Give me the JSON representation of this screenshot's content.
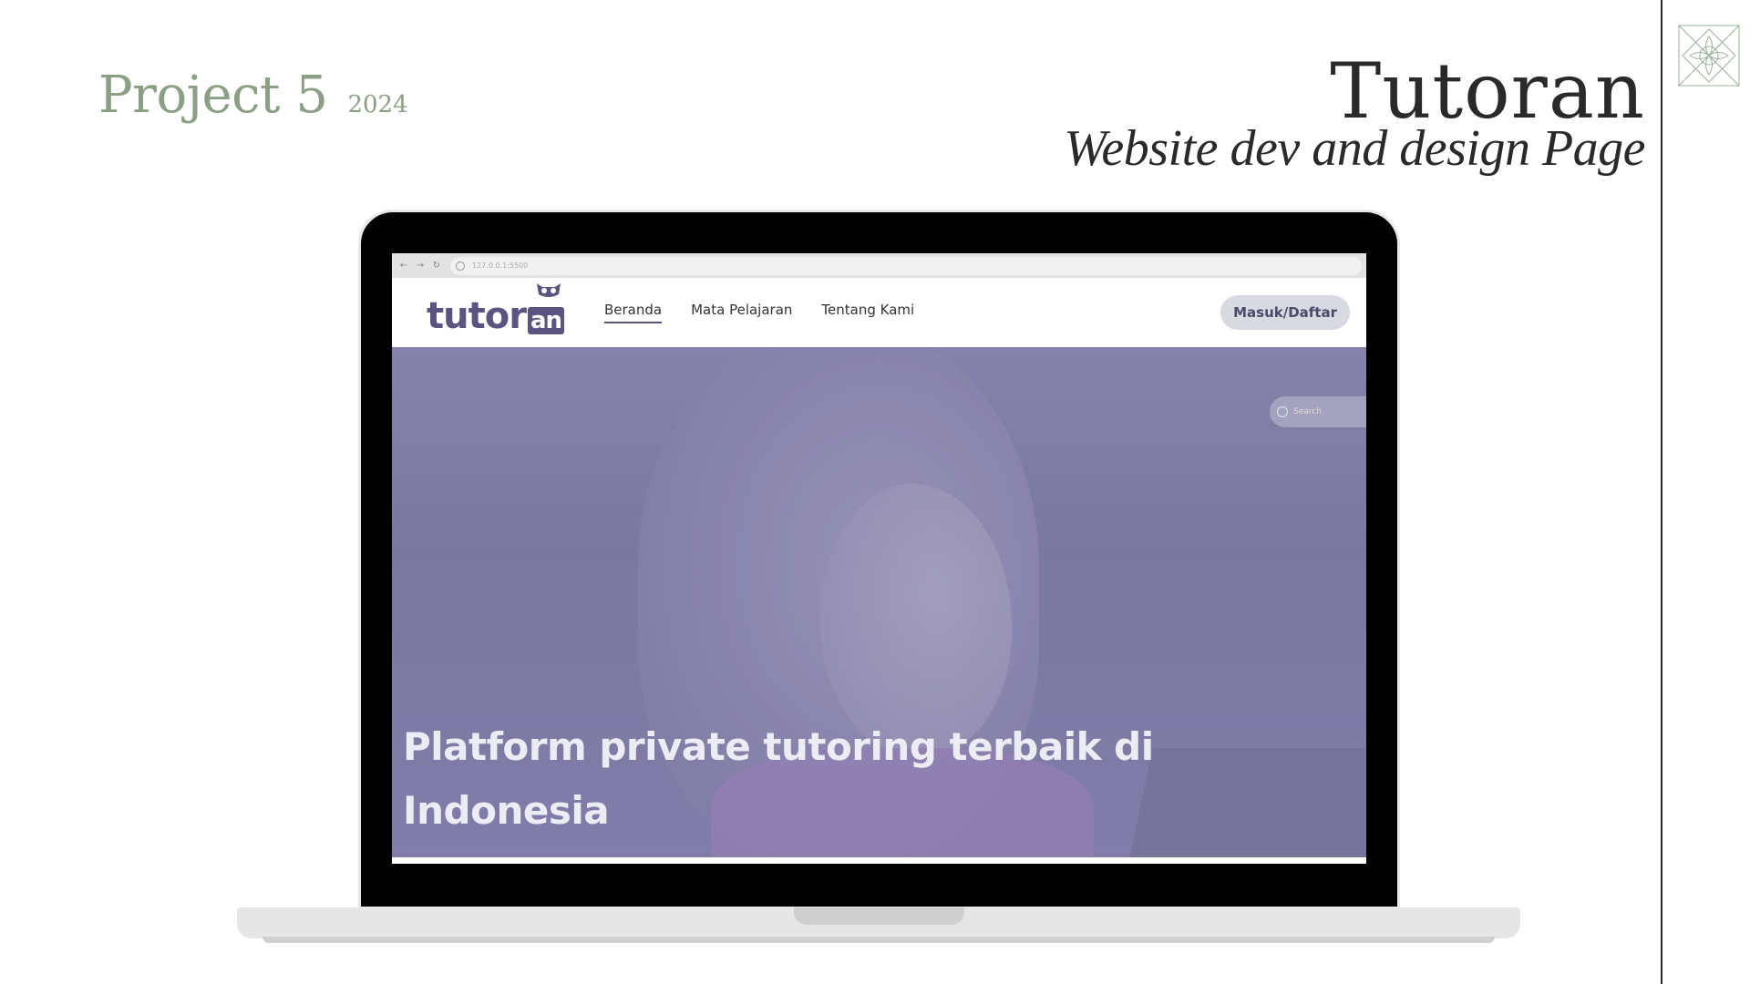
{
  "slide": {
    "project_title": "Project 5",
    "project_year": "2024",
    "main_title": "Tutoran",
    "sub_title": "Website dev and design Page",
    "ornament_icon": "geometric-ornament-icon",
    "accent_color": "#8a9f84"
  },
  "browser": {
    "url": "127.0.0.1:5500"
  },
  "site": {
    "logo_main": "tutor",
    "logo_suffix": "an",
    "brand_color": "#5b5480",
    "nav": [
      {
        "label": "Beranda",
        "active": true
      },
      {
        "label": "Mata Pelajaran",
        "active": false
      },
      {
        "label": "Tentang Kami",
        "active": false
      }
    ],
    "login_label": "Masuk/Daftar",
    "search_placeholder": "Search",
    "hero_headline": "Platform private tutoring terbaik di Indonesia"
  }
}
